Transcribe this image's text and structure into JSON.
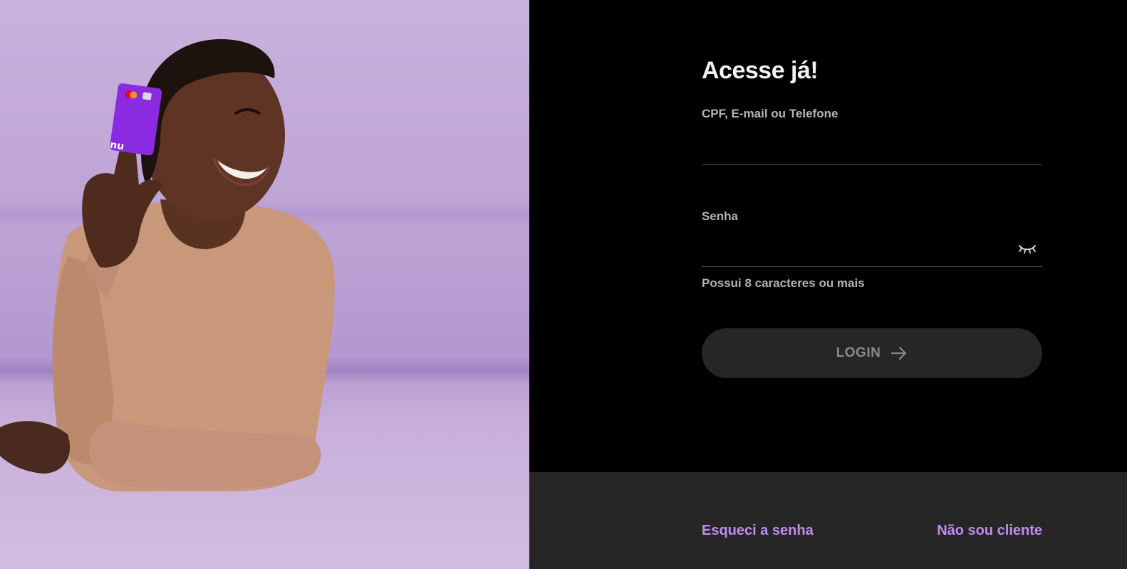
{
  "login": {
    "title": "Acesse já!",
    "username_label": "CPF, E-mail ou Telefone",
    "username_value": "",
    "password_label": "Senha",
    "password_value": "",
    "password_hint": "Possui 8 caracteres ou mais",
    "submit_label": "LOGIN"
  },
  "footer": {
    "forgot_password": "Esqueci a senha",
    "not_client": "Não sou cliente"
  },
  "card": {
    "brand": "nu"
  },
  "colors": {
    "accent": "#c28cf0",
    "background": "#000000",
    "footer_bg": "#262626",
    "button_bg": "#262626",
    "card": "#8a2be2"
  },
  "icons": {
    "password_toggle": "eye-closed-icon",
    "submit_arrow": "arrow-right-icon"
  }
}
